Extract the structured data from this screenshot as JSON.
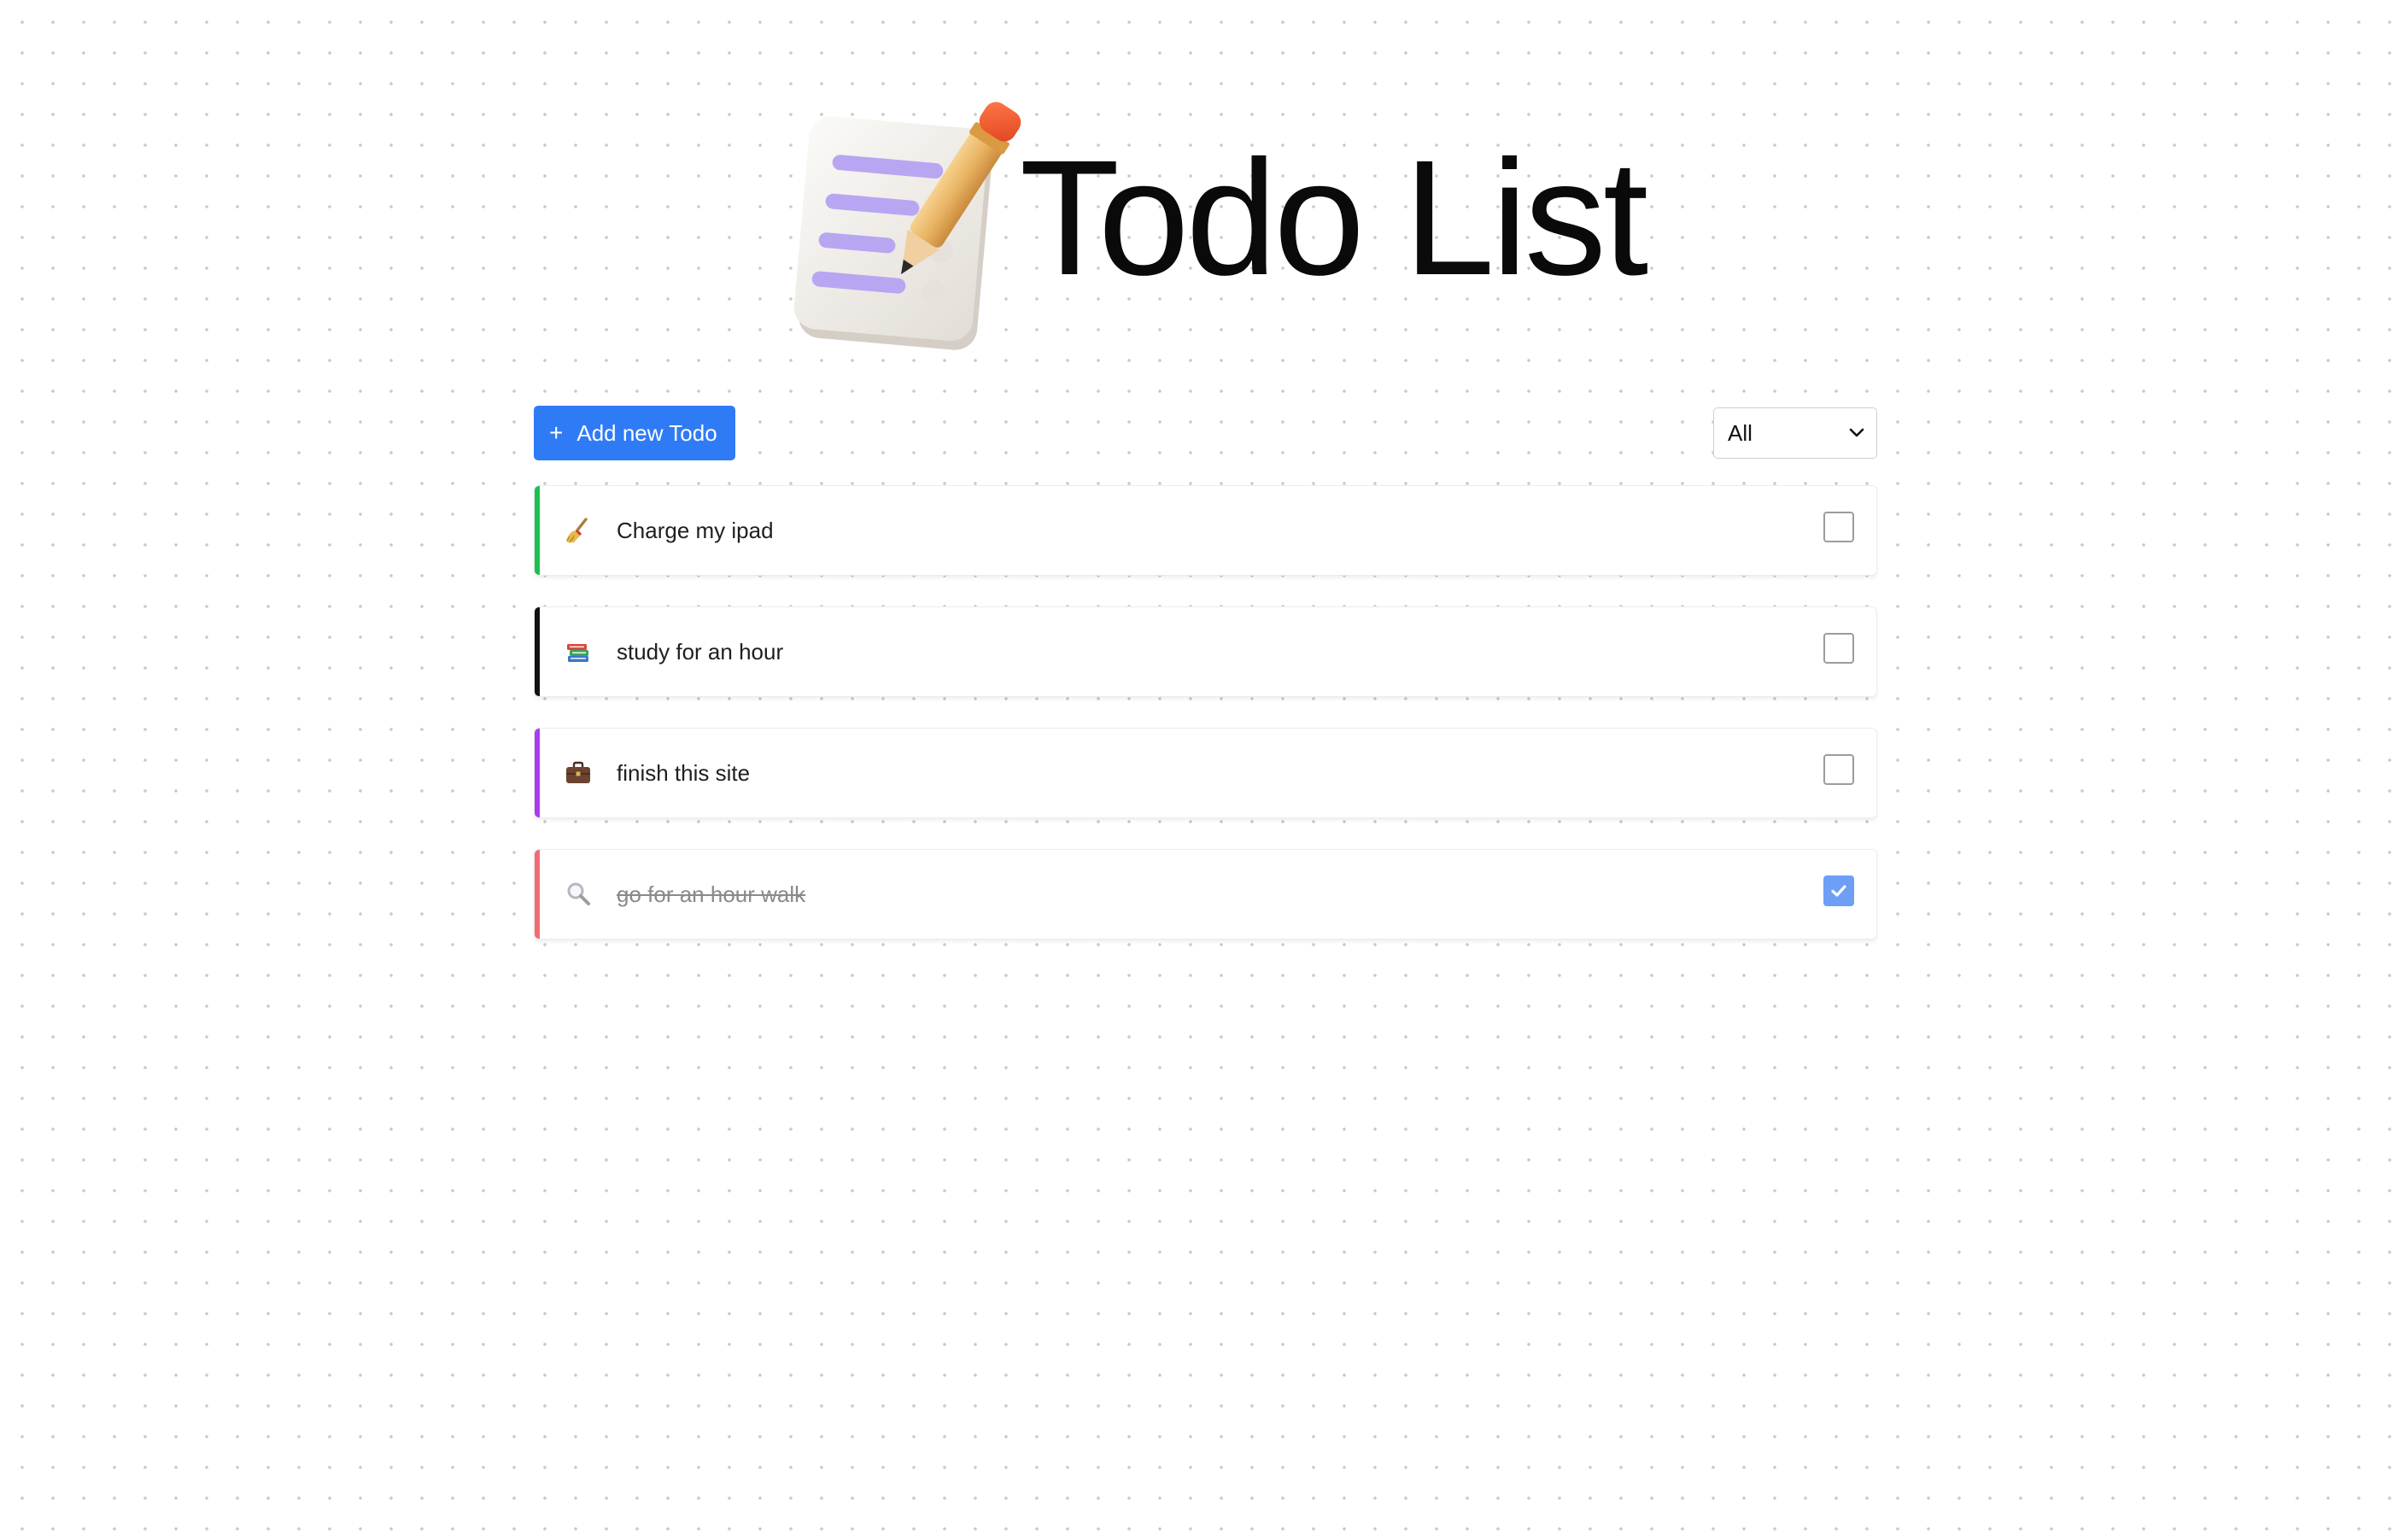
{
  "header": {
    "title": "Todo List",
    "logo_icon": "notepad-pencil-icon"
  },
  "toolbar": {
    "add_button_icon": "plus-icon",
    "add_button_label": "Add new Todo",
    "filter": {
      "selected": "All"
    }
  },
  "todos": [
    {
      "text": "Charge my ipad",
      "icon": "broom-icon",
      "accent_color": "#1cbf4f",
      "completed": false
    },
    {
      "text": "study for an hour",
      "icon": "books-icon",
      "accent_color": "#111111",
      "completed": false
    },
    {
      "text": "finish this site",
      "icon": "briefcase-icon",
      "accent_color": "#a93cf0",
      "completed": false
    },
    {
      "text": "go for an hour walk",
      "icon": "magnifier-icon",
      "accent_color": "#f26b74",
      "completed": true
    }
  ],
  "colors": {
    "primary": "#2f7bf5",
    "checkbox_checked": "#6e9ff7"
  }
}
